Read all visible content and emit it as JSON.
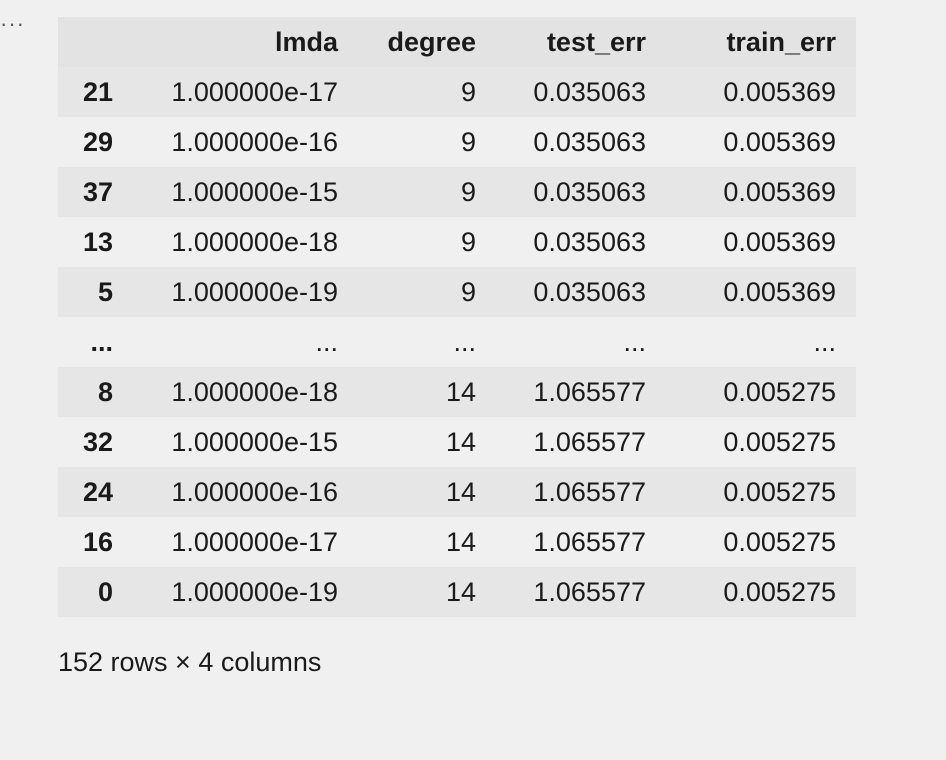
{
  "cell_menu": {
    "label": "···"
  },
  "dataframe": {
    "columns": [
      "",
      "lmda",
      "degree",
      "test_err",
      "train_err"
    ],
    "rows": [
      [
        "21",
        "1.000000e-17",
        "9",
        "0.035063",
        "0.005369"
      ],
      [
        "29",
        "1.000000e-16",
        "9",
        "0.035063",
        "0.005369"
      ],
      [
        "37",
        "1.000000e-15",
        "9",
        "0.035063",
        "0.005369"
      ],
      [
        "13",
        "1.000000e-18",
        "9",
        "0.035063",
        "0.005369"
      ],
      [
        "5",
        "1.000000e-19",
        "9",
        "0.035063",
        "0.005369"
      ],
      [
        "...",
        "...",
        "...",
        "...",
        "..."
      ],
      [
        "8",
        "1.000000e-18",
        "14",
        "1.065577",
        "0.005275"
      ],
      [
        "32",
        "1.000000e-15",
        "14",
        "1.065577",
        "0.005275"
      ],
      [
        "24",
        "1.000000e-16",
        "14",
        "1.065577",
        "0.005275"
      ],
      [
        "16",
        "1.000000e-17",
        "14",
        "1.065577",
        "0.005275"
      ],
      [
        "0",
        "1.000000e-19",
        "14",
        "1.065577",
        "0.005275"
      ]
    ],
    "footer": "152 rows × 4 columns"
  }
}
